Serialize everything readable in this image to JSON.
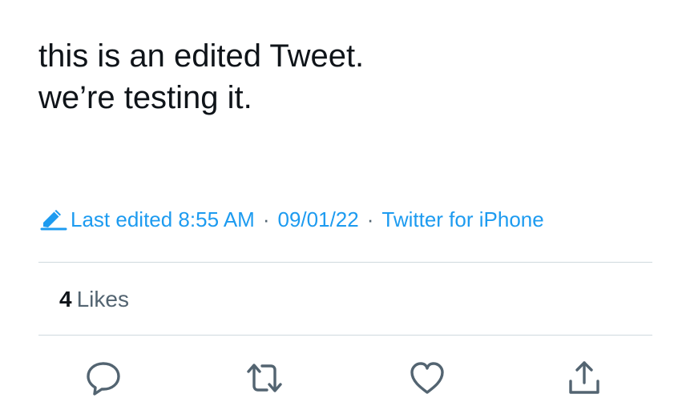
{
  "tweet": {
    "text_line1": "this is an edited Tweet.",
    "text_line2": "we’re testing it."
  },
  "meta": {
    "edited_label": "Last edited 8:55 AM",
    "separator": "·",
    "date": "09/01/22",
    "source": "Twitter for iPhone",
    "icon": "pencil-icon"
  },
  "stats": {
    "likes_count": "4",
    "likes_label": "Likes"
  },
  "actions": {
    "reply_icon": "reply-icon",
    "retweet_icon": "retweet-icon",
    "like_icon": "heart-icon",
    "share_icon": "share-icon"
  },
  "colors": {
    "accent": "#1d9bf0",
    "text": "#0f1419",
    "secondary": "#536471",
    "divider": "#cfd9de"
  }
}
